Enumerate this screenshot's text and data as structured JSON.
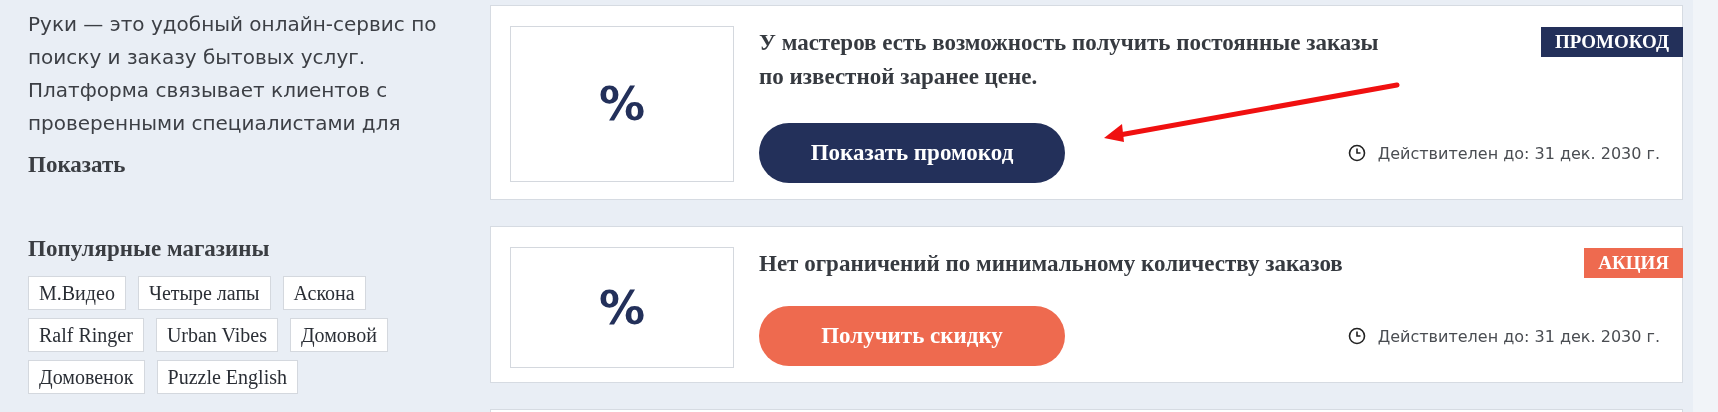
{
  "about": {
    "text": "Руки — это удобный онлайн-сервис по поиску и заказу бытовых услуг. Платформа связывает клиентов с проверенными специалистами для",
    "more_link": "Показать"
  },
  "popular_stores": {
    "title": "Популярные магазины",
    "tags": [
      "М.Видео",
      "Четыре лапы",
      "Аскона",
      "Ralf Ringer",
      "Urban Vibes",
      "Домовой",
      "Домовенок",
      "Puzzle English"
    ]
  },
  "offers": [
    {
      "kind": "promocode",
      "badge": "ПРОМОКОД",
      "image_text": "%",
      "title": "У мастеров есть возможность получить постоянные заказы по известной заранее цене.",
      "button": "Показать промокод",
      "valid_until": "Действителен до: 31 дек. 2030 г."
    },
    {
      "kind": "sale",
      "badge": "АКЦИЯ",
      "image_text": "%",
      "title": "Нет ограничений по минимальному количеству заказов",
      "button": "Получить скидку",
      "valid_until": "Действителен до: 31 дек. 2030 г."
    }
  ]
}
